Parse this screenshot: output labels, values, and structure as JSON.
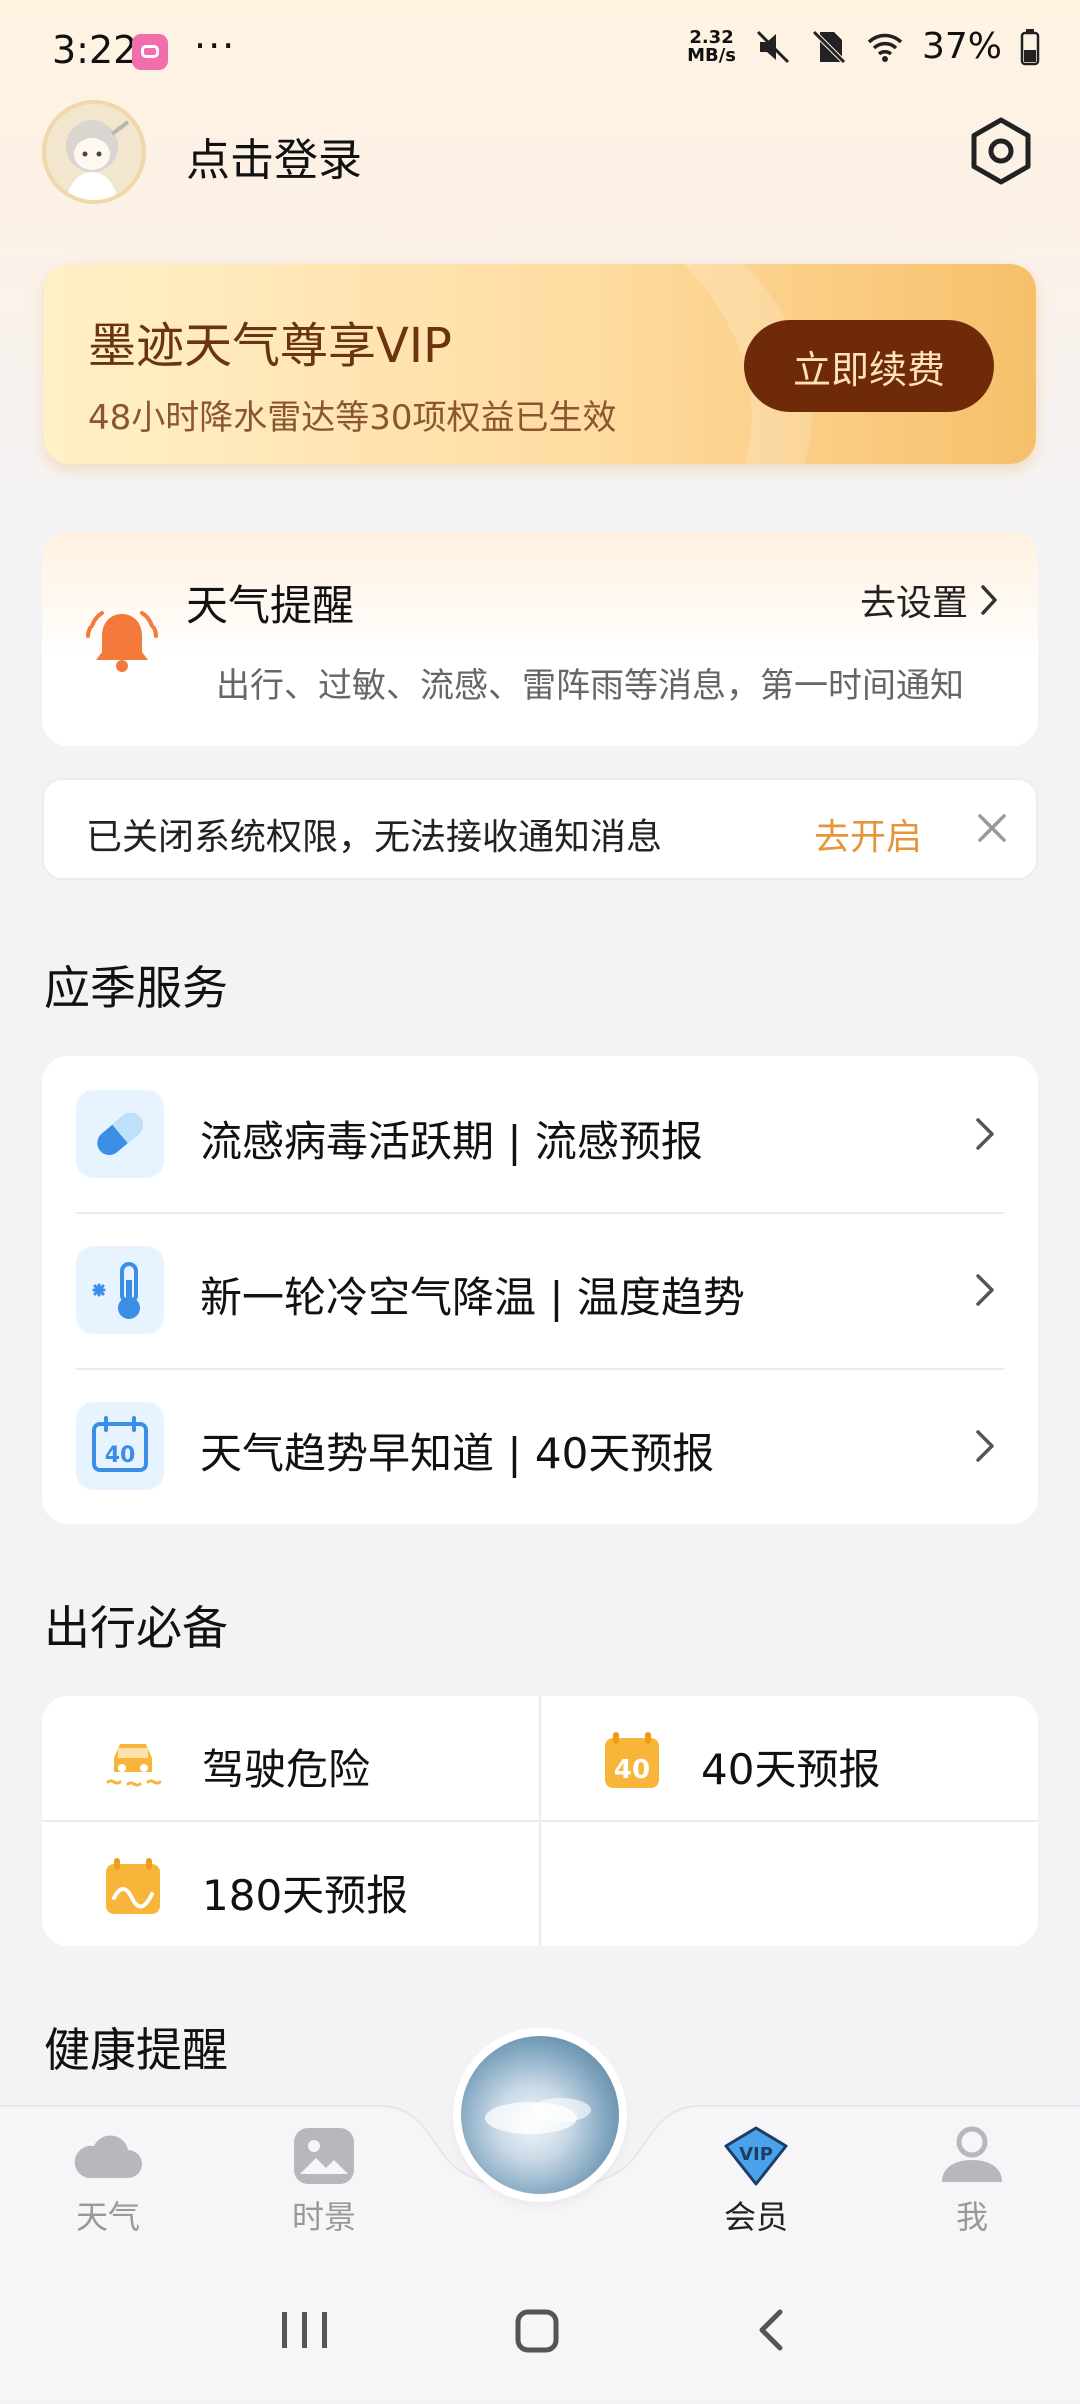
{
  "status_bar": {
    "time": "3:22",
    "dots": "···",
    "net_speed_value": "2.32",
    "net_speed_unit": "MB/s",
    "battery": "37%"
  },
  "header": {
    "login_label": "点击登录"
  },
  "vip_card": {
    "title": "墨迹天气尊享VIP",
    "subtitle": "48小时降水雷达等30项权益已生效",
    "renew_button": "立即续费"
  },
  "weather_reminder": {
    "title": "天气提醒",
    "action": "去设置",
    "description": "出行、过敏、流感、雷阵雨等消息，第一时间通知"
  },
  "permission_notice": {
    "text": "已关闭系统权限，无法接收通知消息",
    "action": "去开启"
  },
  "seasonal_services": {
    "title": "应季服务",
    "items": [
      {
        "label": "流感病毒活跃期 | 流感预报",
        "icon": "pill-icon"
      },
      {
        "label": "新一轮冷空气降温 | 温度趋势",
        "icon": "thermometer-icon"
      },
      {
        "label": "天气趋势早知道 | 40天预报",
        "icon": "calendar-40-icon"
      }
    ]
  },
  "travel_essentials": {
    "title": "出行必备",
    "items": [
      {
        "label": "驾驶危险",
        "icon": "car-skid-icon"
      },
      {
        "label": "40天预报",
        "icon": "calendar-40-icon"
      },
      {
        "label": "180天预报",
        "icon": "calendar-wave-icon"
      }
    ]
  },
  "health_reminder": {
    "title": "健康提醒"
  },
  "bottom_nav": {
    "items": [
      {
        "label": "天气",
        "icon": "cloud-icon",
        "active": false
      },
      {
        "label": "时景",
        "icon": "image-icon",
        "active": false
      },
      {
        "label": "会员",
        "icon": "vip-diamond-icon",
        "active": true
      },
      {
        "label": "我",
        "icon": "person-icon",
        "active": false
      }
    ],
    "vip_badge_text": "VIP"
  },
  "colors": {
    "accent_orange": "#e6953a",
    "vip_button": "#6e2a09",
    "vip_text": "#6b3411",
    "service_icon_blue": "#3a8ee6"
  }
}
